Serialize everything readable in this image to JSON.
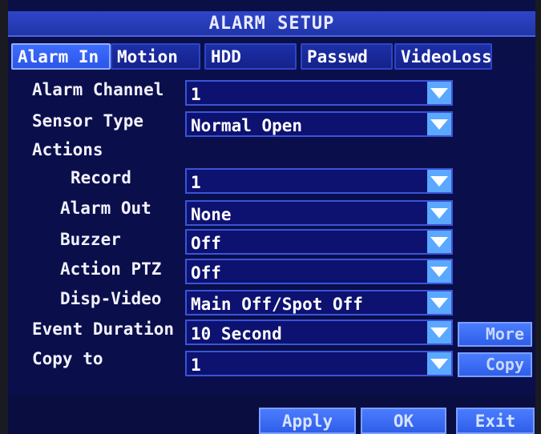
{
  "title": "ALARM SETUP",
  "tabs": [
    {
      "label": "Alarm In",
      "active": true
    },
    {
      "label": "Motion",
      "active": false
    },
    {
      "label": "HDD",
      "active": false
    },
    {
      "label": "Passwd",
      "active": false
    },
    {
      "label": "VideoLoss",
      "active": false
    }
  ],
  "fields": {
    "alarm_channel": {
      "label": "Alarm Channel",
      "value": "1"
    },
    "sensor_type": {
      "label": "Sensor Type",
      "value": "Normal Open"
    },
    "actions_heading": "Actions",
    "record": {
      "label": "Record",
      "value": "1"
    },
    "alarm_out": {
      "label": "Alarm Out",
      "value": "None"
    },
    "buzzer": {
      "label": "Buzzer",
      "value": "Off"
    },
    "action_ptz": {
      "label": "Action PTZ",
      "value": "Off"
    },
    "disp_video": {
      "label": "Disp-Video",
      "value": "Main Off/Spot Off"
    },
    "event_duration": {
      "label": "Event Duration",
      "value": "10 Second"
    },
    "copy_to": {
      "label": "Copy to",
      "value": "1"
    }
  },
  "side_buttons": {
    "more": "More",
    "copy": "Copy"
  },
  "footer_buttons": {
    "apply": "Apply",
    "ok": "OK",
    "exit": "Exit"
  },
  "colors": {
    "accent": "#2f5ee8",
    "dropdown": "#5aa8ff",
    "background": "#0a0e4a"
  }
}
